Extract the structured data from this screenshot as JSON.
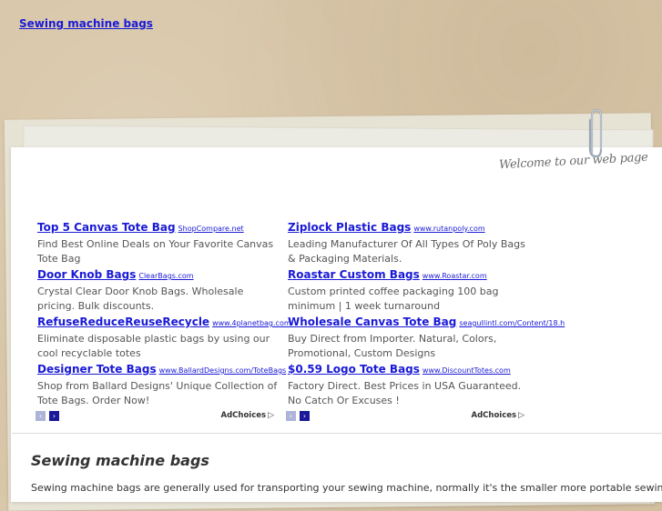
{
  "header": {
    "top_link": "Sewing machine bags"
  },
  "banner": {
    "welcome": "Welcome to our web page"
  },
  "ads": {
    "left": [
      {
        "title": "Top 5 Canvas Tote Bag",
        "url": "ShopCompare.net",
        "desc": "Find Best Online Deals on Your Favorite Canvas Tote Bag"
      },
      {
        "title": "Door Knob Bags",
        "url": "ClearBags.com",
        "desc": "Crystal Clear Door Knob Bags. Wholesale pricing. Bulk discounts."
      },
      {
        "title": "RefuseReduceReuseRecycle",
        "url": "www.4planetbag.com",
        "desc": "Eliminate disposable plastic bags by using our cool recyclable totes"
      },
      {
        "title": "Designer Tote Bags",
        "url": "www.BallardDesigns.com/ToteBags",
        "desc": "Shop from Ballard Designs' Unique Collection of Tote Bags. Order Now!"
      }
    ],
    "right": [
      {
        "title": "Ziplock Plastic Bags",
        "url": "www.rutanpoly.com",
        "desc": "Leading Manufacturer Of All Types Of Poly Bags & Packaging Materials."
      },
      {
        "title": "Roastar Custom Bags",
        "url": "www.Roastar.com",
        "desc": "Custom printed coffee packaging 100 bag minimum | 1 week turnaround"
      },
      {
        "title": "Wholesale Canvas Tote Bag",
        "url": "seagullintl.com/Content/18.h",
        "desc": "Buy Direct from Importer. Natural, Colors, Promotional, Custom Designs"
      },
      {
        "title": "$0.59 Logo Tote Bags",
        "url": "www.DiscountTotes.com",
        "desc": "Factory Direct. Best Prices in USA Guaranteed. No Catch Or Excuses !"
      }
    ],
    "nav": {
      "prev": "‹",
      "next": "›",
      "adchoices": "AdChoices",
      "adchoices_icon": "▷"
    }
  },
  "article": {
    "heading": "Sewing machine bags",
    "body": "Sewing machine bags are generally used for transporting your sewing machine, normally it's the smaller more portable sewing"
  },
  "colors": {
    "link": "#1a1ad6",
    "background": "#d8c6a8"
  }
}
